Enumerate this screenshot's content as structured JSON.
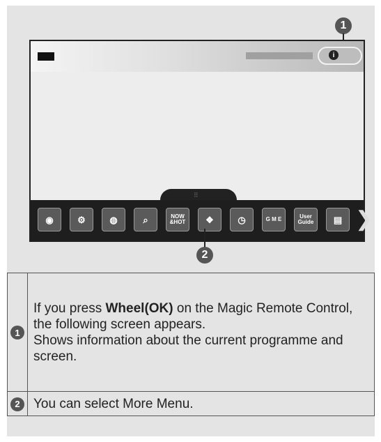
{
  "callouts": [
    "1",
    "2"
  ],
  "screen": {
    "info_icon": "i",
    "menu_icons": [
      {
        "name": "input-icon",
        "glyph": "◉"
      },
      {
        "name": "settings-icon",
        "glyph": "⚙"
      },
      {
        "name": "internet-icon",
        "glyph": "◍"
      },
      {
        "name": "search-icon",
        "glyph": "⌕"
      },
      {
        "name": "now-hot-icon",
        "glyph": "NOW &HOT"
      },
      {
        "name": "smart-share-icon",
        "glyph": "❖"
      },
      {
        "name": "clock-icon",
        "glyph": "◷"
      },
      {
        "name": "game-icon",
        "glyph": "G M E"
      },
      {
        "name": "user-guide-icon",
        "glyph": "User Guide"
      },
      {
        "name": "card-icon",
        "glyph": "▤"
      }
    ],
    "more_arrow": "❯"
  },
  "legend": [
    {
      "num": "1",
      "parts": [
        {
          "text": "If you press ",
          "bold": false
        },
        {
          "text": "Wheel(OK)",
          "bold": true
        },
        {
          "text": " on the Magic Remote Control, the following screen appears.",
          "bold": false
        }
      ],
      "line2": "Shows information about the current programme and screen."
    },
    {
      "num": "2",
      "parts": [
        {
          "text": "You can select More Menu.",
          "bold": false
        }
      ],
      "line2": ""
    }
  ]
}
